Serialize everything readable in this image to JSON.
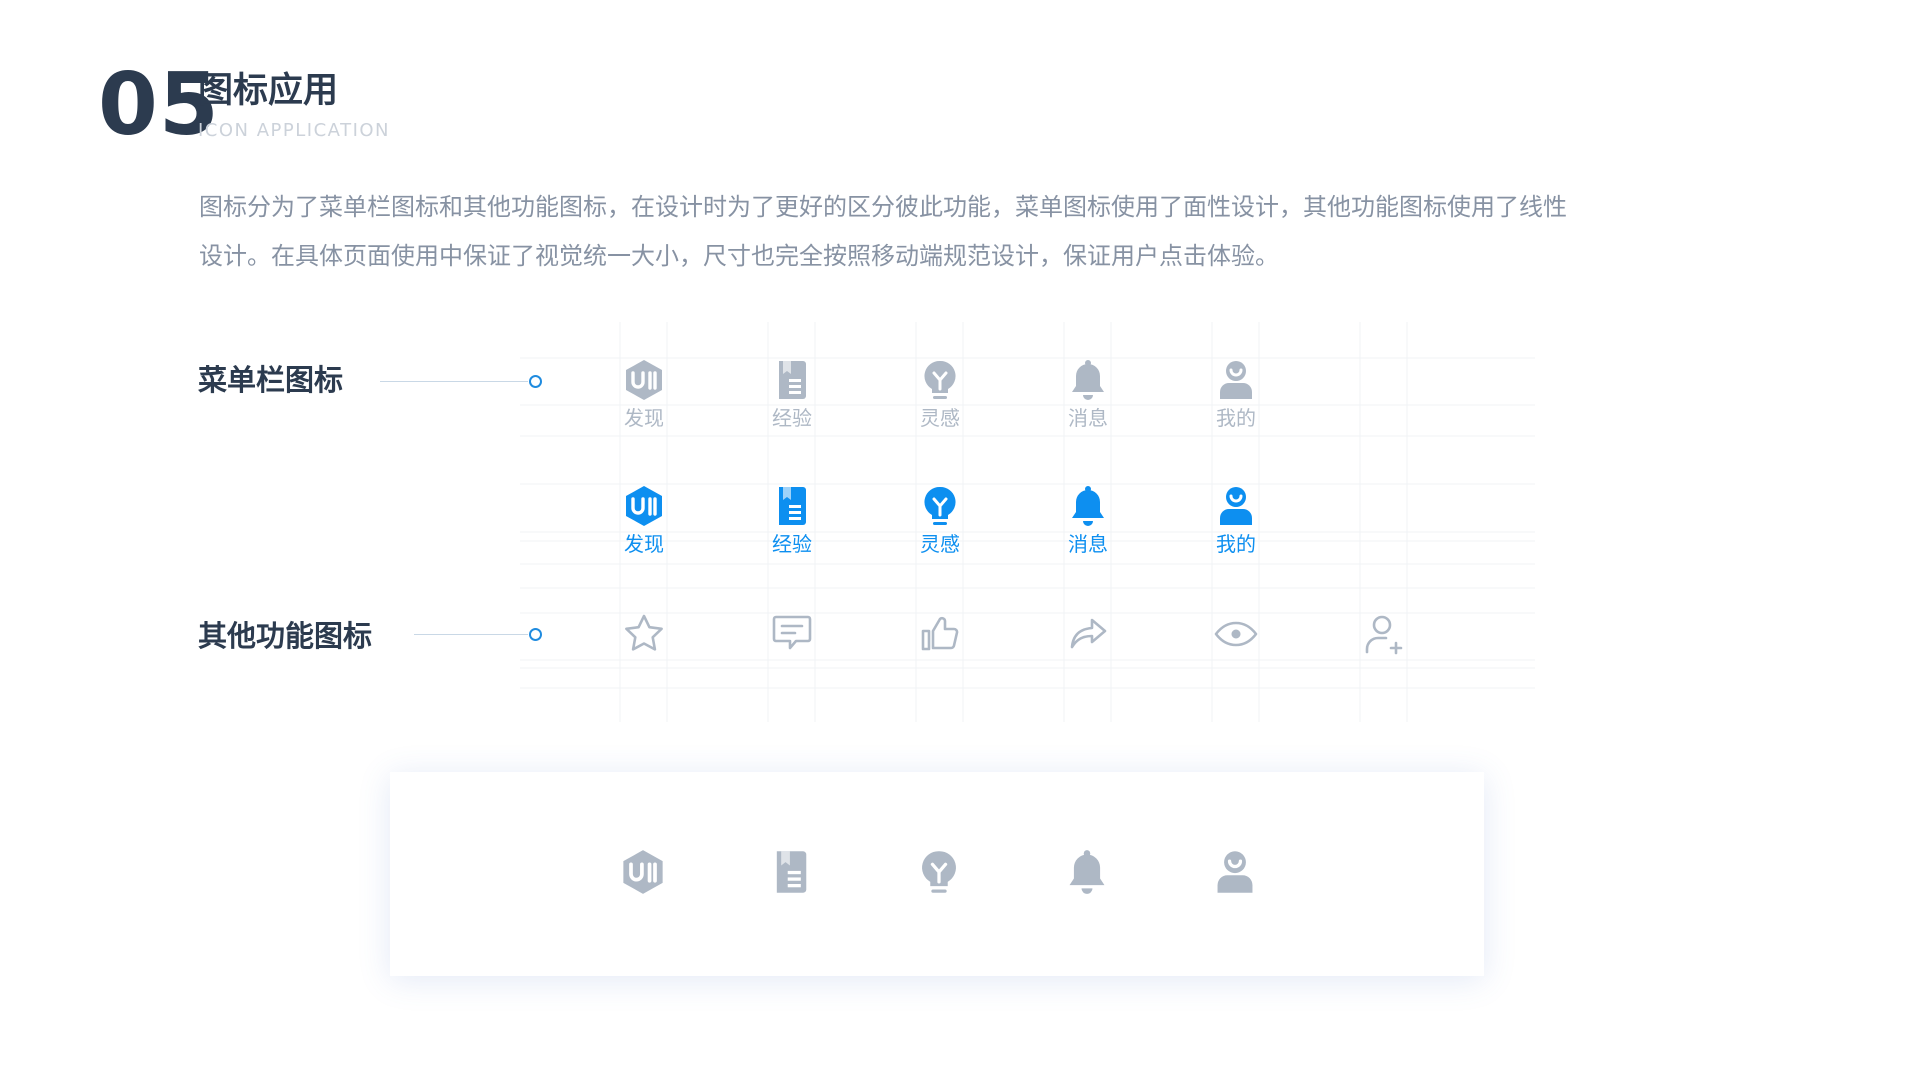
{
  "header": {
    "number": "05",
    "title": "图标应用",
    "subtitle": "ICON APPLICATION"
  },
  "description": {
    "line1": "图标分为了菜单栏图标和其他功能图标，在设计时为了更好的区分彼此功能，菜单图标使用了面性设计，其他功能图标使用了线性",
    "line2": "设计。在具体页面使用中保证了视觉统一大小，尺寸也完全按照移动端规范设计，保证用户点击体验。"
  },
  "menu_section": {
    "label": "菜单栏图标",
    "items": [
      {
        "label": "发现",
        "icon": "ui-hexagon-icon"
      },
      {
        "label": "经验",
        "icon": "book-icon"
      },
      {
        "label": "灵感",
        "icon": "lightbulb-icon"
      },
      {
        "label": "消息",
        "icon": "bell-icon"
      },
      {
        "label": "我的",
        "icon": "user-icon"
      }
    ]
  },
  "other_section": {
    "label": "其他功能图标",
    "icons": [
      "star-icon",
      "comment-icon",
      "thumbs-up-icon",
      "share-icon",
      "eye-icon",
      "add-user-icon"
    ]
  },
  "colors": {
    "inactive": "#aeb8c5",
    "active": "#0d8ff0",
    "title": "#2c3b4f",
    "text": "#8792a3"
  }
}
